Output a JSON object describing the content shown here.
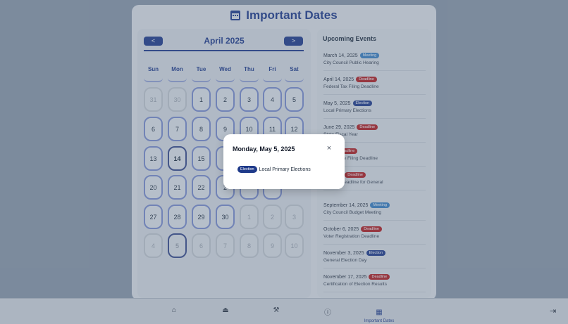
{
  "app": {
    "title": "Important Dates",
    "icon": "calendar-icon"
  },
  "calendar": {
    "prev_label": "<",
    "next_label": ">",
    "month": "April 2025",
    "weekdays": [
      "Sun",
      "Mon",
      "Tue",
      "Wed",
      "Thu",
      "Fri",
      "Sat"
    ],
    "weeks": [
      [
        "31",
        "30",
        "1",
        "2",
        "3",
        "4",
        "5"
      ],
      [
        "6",
        "7",
        "8",
        "9",
        "10",
        "11",
        "12"
      ],
      [
        "13",
        "14",
        "15",
        "",
        "",
        "",
        ""
      ],
      [
        "20",
        "21",
        "22",
        "2",
        "",
        "",
        ""
      ],
      [
        "27",
        "28",
        "29",
        "30",
        "1",
        "2",
        "3"
      ],
      [
        "4",
        "5",
        "6",
        "7",
        "8",
        "9",
        "10"
      ]
    ]
  },
  "events": {
    "title": "Upcoming Events",
    "items": [
      {
        "date": "March 14, 2025",
        "type": "Meeting",
        "name": "City Council Public Hearing"
      },
      {
        "date": "April 14, 2025",
        "type": "Deadline",
        "name": "Federal Tax Filing Deadline"
      },
      {
        "date": "May 5, 2025",
        "type": "Election",
        "name": "Local Primary Elections"
      },
      {
        "date": "June 29, 2025",
        "type": "Deadline",
        "name": "State Fiscal Year"
      },
      {
        "date": "2025",
        "type": "Deadline",
        "name": "gn Finance Filing Deadline"
      },
      {
        "date": "19, 2025",
        "type": "Deadline",
        "name": "te Filing Deadline for General"
      },
      {
        "date": "September 14, 2025",
        "type": "Meeting",
        "name": "City Council Budget Meeting"
      },
      {
        "date": "October 6, 2025",
        "type": "Deadline",
        "name": "Voter Registration Deadline"
      },
      {
        "date": "November 3, 2025",
        "type": "Election",
        "name": "General Election Day"
      },
      {
        "date": "November 17, 2025",
        "type": "Deadline",
        "name": "Certification of Election Results"
      }
    ]
  },
  "modal": {
    "title": "Monday, May 5, 2025",
    "close_label": "×",
    "event_badge": "Election",
    "event_name": "Local Primary Elections"
  },
  "bottom_nav": {
    "items": [
      "home-icon",
      "stamp-icon",
      "gavel-icon",
      "info-icon"
    ],
    "active_label": "Important Dates",
    "active_icon": "calendar-icon",
    "logout_icon": "logout-icon"
  },
  "colors": {
    "accent": "#1f3a8a",
    "meeting": "#3b82c4",
    "deadline": "#b91c1c",
    "election": "#1f3a8a"
  }
}
